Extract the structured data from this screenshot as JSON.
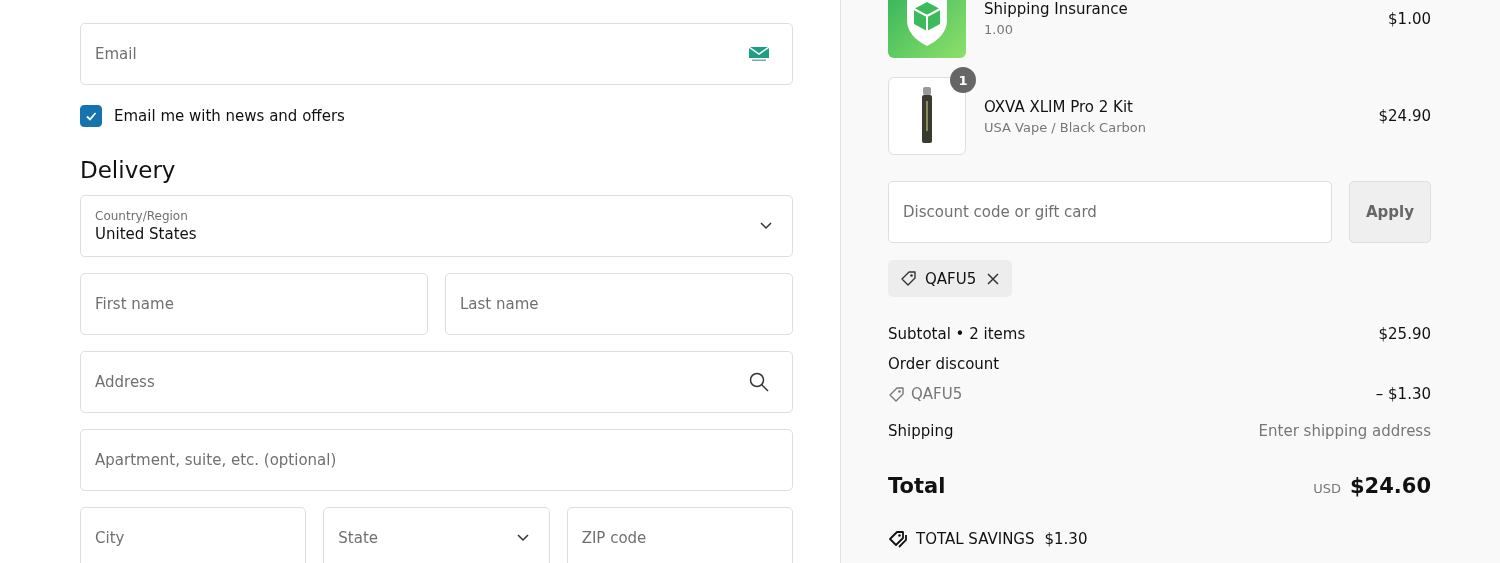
{
  "contact": {
    "email": {
      "placeholder": "Email"
    },
    "marketing_opt_in": {
      "label": "Email me with news and offers",
      "checked": true
    }
  },
  "delivery": {
    "heading": "Delivery",
    "country": {
      "label": "Country/Region",
      "value": "United States"
    },
    "first_name": {
      "placeholder": "First name"
    },
    "last_name": {
      "placeholder": "Last name"
    },
    "address": {
      "placeholder": "Address"
    },
    "apartment": {
      "placeholder": "Apartment, suite, etc. (optional)"
    },
    "city": {
      "placeholder": "City"
    },
    "state": {
      "placeholder": "State"
    },
    "zip": {
      "placeholder": "ZIP code"
    }
  },
  "order_summary": {
    "items": [
      {
        "kind": "insurance",
        "name": "Shipping Insurance",
        "variant": "1.00",
        "price": "$1.00"
      },
      {
        "kind": "product",
        "name": "OXVA XLIM Pro 2 Kit",
        "variant": "USA Vape / Black Carbon",
        "price": "$24.90",
        "quantity": "1"
      }
    ],
    "discount": {
      "placeholder": "Discount code or gift card",
      "button": "Apply"
    },
    "applied_codes": [
      {
        "code": "QAFU5"
      }
    ],
    "subtotal": {
      "label": "Subtotal • 2 items",
      "value": "$25.90"
    },
    "order_discount": {
      "label": "Order discount",
      "code": "QAFU5",
      "value": "– $1.30"
    },
    "shipping": {
      "label": "Shipping",
      "value": "Enter shipping address"
    },
    "total": {
      "label": "Total",
      "currency": "USD",
      "value": "$24.60"
    },
    "savings": {
      "label": "TOTAL SAVINGS",
      "value": "$1.30"
    }
  }
}
